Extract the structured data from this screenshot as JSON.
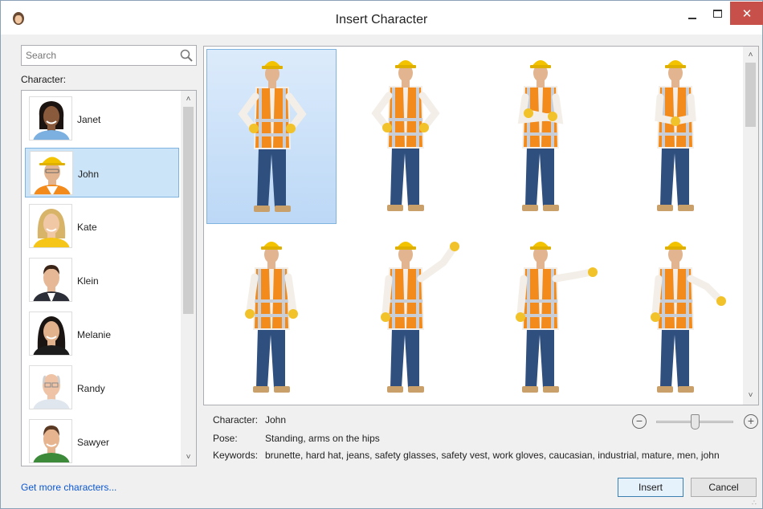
{
  "window": {
    "title": "Insert Character",
    "app_icon": "character-face-icon",
    "controls": {
      "minimize": "–",
      "maximize": "□",
      "close": "✕"
    }
  },
  "search": {
    "placeholder": "Search",
    "value": ""
  },
  "character_list": {
    "label": "Character:",
    "selected": "John",
    "items": [
      {
        "name": "Janet",
        "skin": "#8a5a3c",
        "hair": "#1c1410",
        "shirt": "#7bb0e0"
      },
      {
        "name": "John",
        "skin": "#e2b48f",
        "hair": "#f3c300",
        "shirt": "#f28a1c"
      },
      {
        "name": "Kate",
        "skin": "#f1c8a5",
        "hair": "#d7b468",
        "shirt": "#f5c518"
      },
      {
        "name": "Klein",
        "skin": "#e6b896",
        "hair": "#3a2418",
        "shirt": "#2c2f38"
      },
      {
        "name": "Melanie",
        "skin": "#e2b28c",
        "hair": "#1a1412",
        "shirt": "#1c1c1c"
      },
      {
        "name": "Randy",
        "skin": "#efc3a6",
        "hair": "#cfcfcf",
        "shirt": "#dfe6ee"
      },
      {
        "name": "Sawyer",
        "skin": "#e6b48e",
        "hair": "#5a3a24",
        "shirt": "#3c8a3a"
      }
    ]
  },
  "more_link": "Get more characters...",
  "poses": {
    "selected_index": 0,
    "items": [
      {
        "pose": "hips"
      },
      {
        "pose": "hips"
      },
      {
        "pose": "arms-crossed"
      },
      {
        "pose": "hands-together"
      },
      {
        "pose": "arms-down"
      },
      {
        "pose": "point-up"
      },
      {
        "pose": "point-side"
      },
      {
        "pose": "point-down"
      }
    ]
  },
  "details": {
    "character_label": "Character:",
    "character_value": "John",
    "pose_label": "Pose:",
    "pose_value": "Standing, arms on the hips",
    "keywords_label": "Keywords:",
    "keywords_value": "brunette, hard hat, jeans, safety glasses, safety vest, work gloves, caucasian, industrial, mature, men, john"
  },
  "zoom": {
    "minus": "−",
    "plus": "+",
    "level": 0.5
  },
  "buttons": {
    "insert": "Insert",
    "cancel": "Cancel"
  },
  "colors": {
    "selection": "#cce4f7",
    "link": "#0b57d0",
    "close": "#c7514a"
  }
}
